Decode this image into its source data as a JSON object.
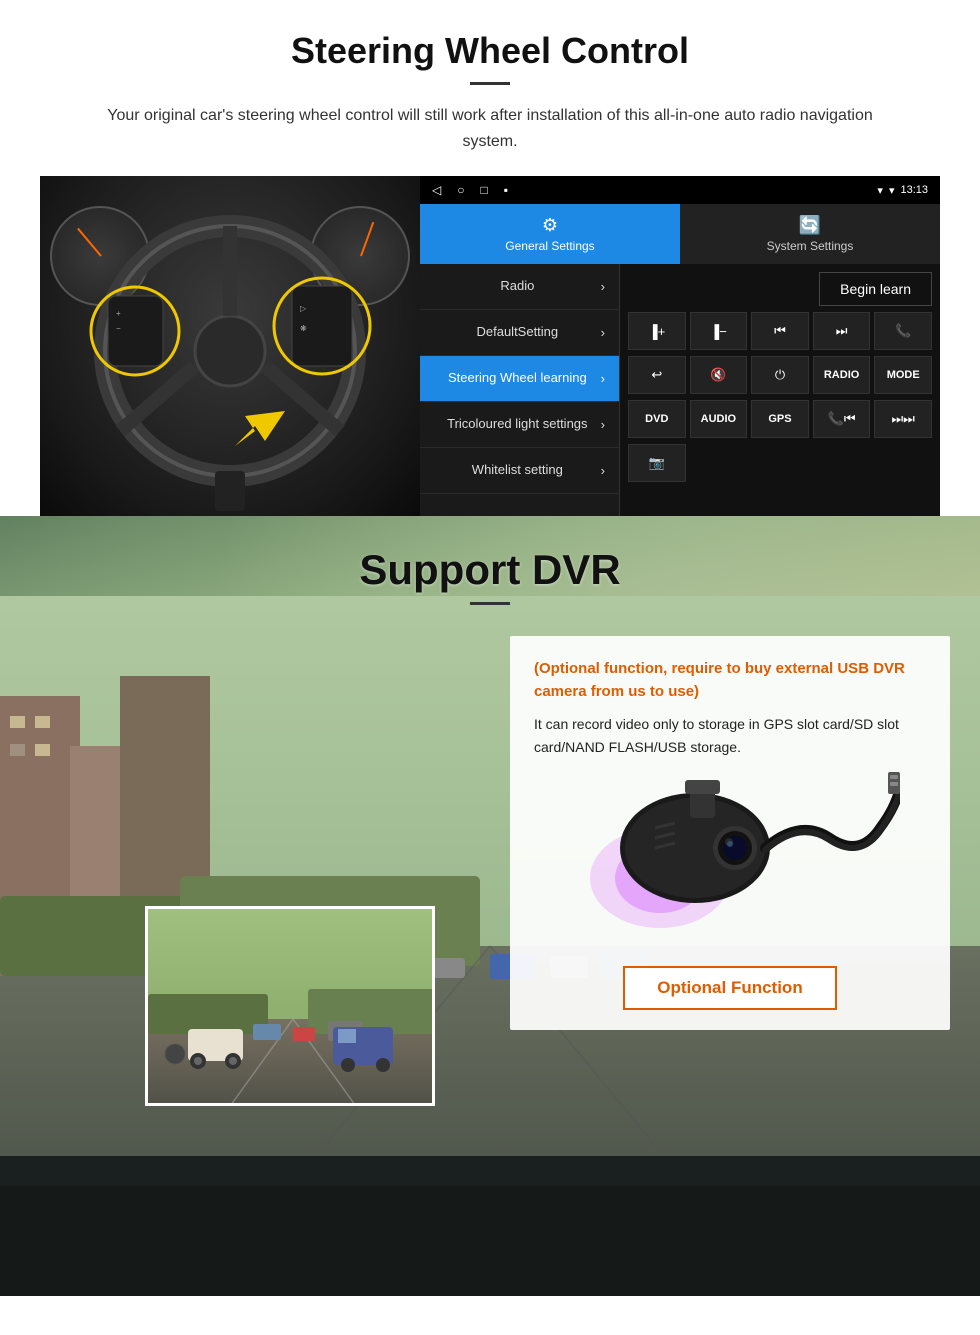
{
  "page": {
    "sections": {
      "steering": {
        "title": "Steering Wheel Control",
        "subtitle": "Your original car's steering wheel control will still work after installation of this all-in-one auto radio navigation system.",
        "android_ui": {
          "status_bar": {
            "time": "13:13",
            "nav_icons": [
              "◁",
              "○",
              "□",
              "▪"
            ]
          },
          "tabs": {
            "general": {
              "label": "General Settings",
              "icon": "⚙"
            },
            "system": {
              "label": "System Settings",
              "icon": "🔄"
            }
          },
          "menu_items": [
            {
              "label": "Radio",
              "active": false
            },
            {
              "label": "DefaultSetting",
              "active": false
            },
            {
              "label": "Steering Wheel learning",
              "active": true
            },
            {
              "label": "Tricoloured light settings",
              "active": false
            },
            {
              "label": "Whitelist setting",
              "active": false
            }
          ],
          "begin_learn_btn": "Begin learn",
          "control_buttons": [
            {
              "label": "▐+",
              "row": 1
            },
            {
              "label": "▐−",
              "row": 1
            },
            {
              "label": "⏮",
              "row": 1
            },
            {
              "label": "⏭",
              "row": 1
            },
            {
              "label": "📞",
              "row": 1
            },
            {
              "label": "↩",
              "row": 2
            },
            {
              "label": "🔇",
              "row": 2
            },
            {
              "label": "⏻",
              "row": 2
            },
            {
              "label": "RADIO",
              "row": 2
            },
            {
              "label": "MODE",
              "row": 2
            },
            {
              "label": "DVD",
              "row": 3
            },
            {
              "label": "AUDIO",
              "row": 3
            },
            {
              "label": "GPS",
              "row": 3
            },
            {
              "label": "📞⏮",
              "row": 3
            },
            {
              "label": "⏭⏭",
              "row": 3
            },
            {
              "label": "📷",
              "row": 4
            }
          ]
        }
      },
      "dvr": {
        "title": "Support DVR",
        "info_card": {
          "optional_text": "(Optional function, require to buy external USB DVR camera from us to use)",
          "description": "It can record video only to storage in GPS slot card/SD slot card/NAND FLASH/USB storage.",
          "optional_fn_btn": "Optional Function"
        }
      }
    }
  }
}
